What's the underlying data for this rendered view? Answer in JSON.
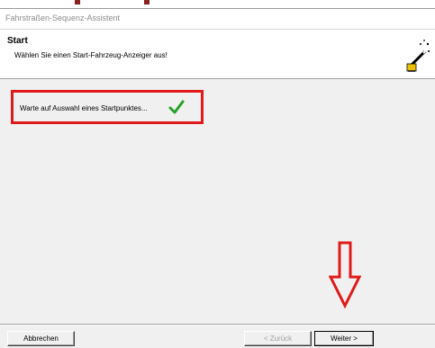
{
  "window": {
    "title": "Fahrstraßen-Sequenz-Assistent"
  },
  "header": {
    "title": "Start",
    "subtitle": "Wählen Sie einen Start-Fahrzeug-Anzeiger aus!"
  },
  "status": {
    "text": "Warte auf Auswahl eines Startpunktes..."
  },
  "buttons": {
    "cancel": "Abbrechen",
    "back": "< Zurück",
    "next": "Weiter >"
  },
  "colors": {
    "highlight": "#e01a1a",
    "check": "#2aa02a"
  },
  "icons": [
    "wizard-wand-icon",
    "checkmark-icon",
    "down-arrow-annotation"
  ]
}
